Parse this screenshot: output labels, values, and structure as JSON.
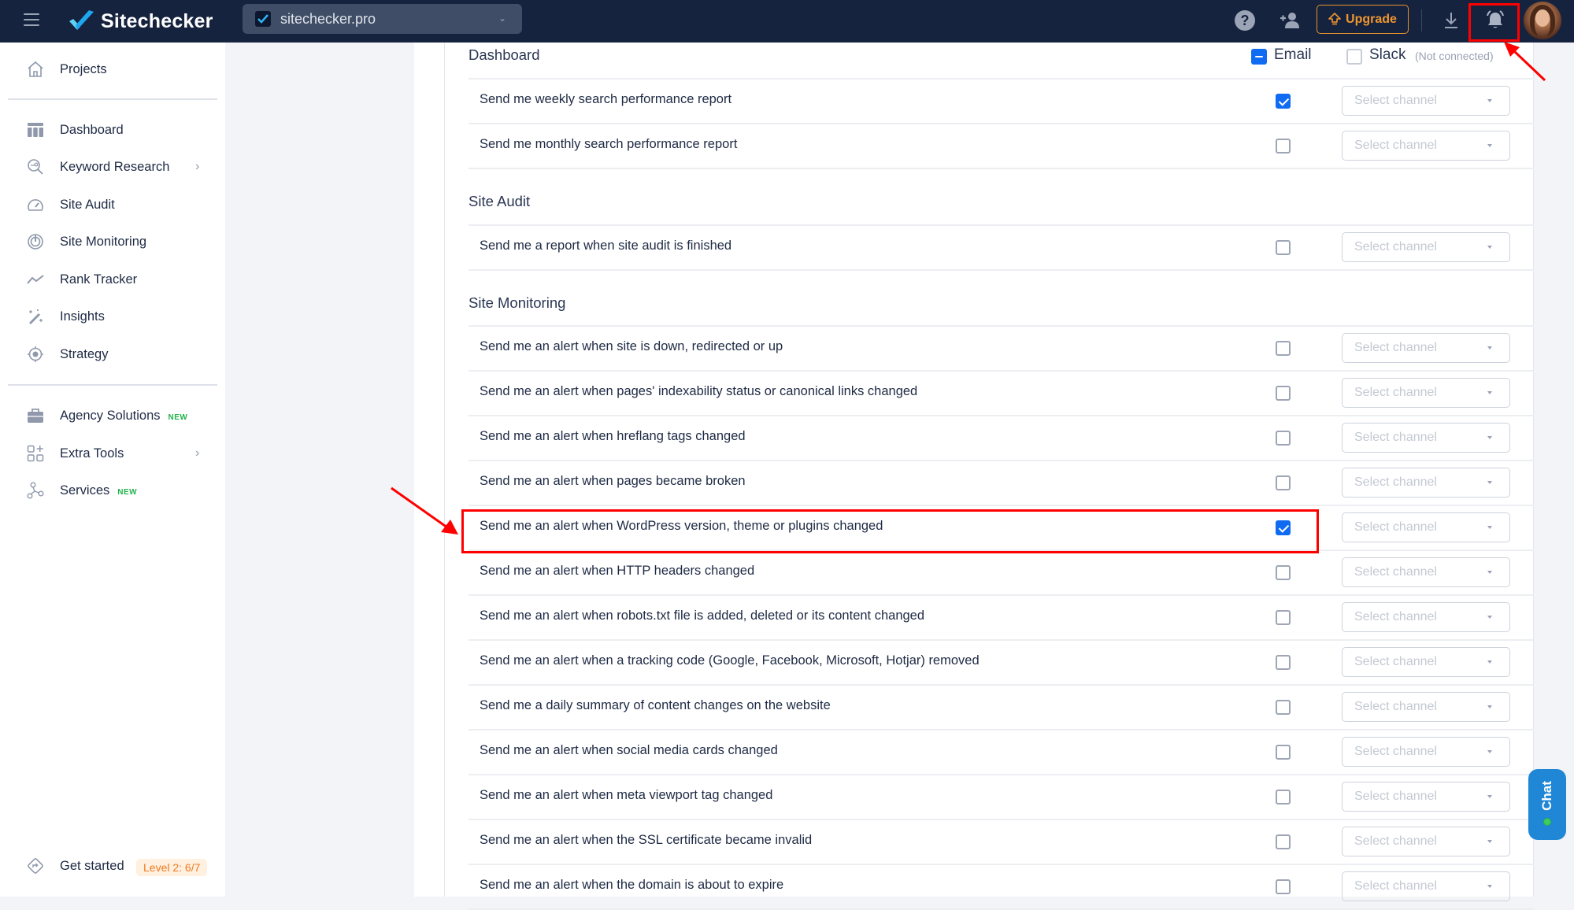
{
  "topbar": {
    "app_name": "Sitechecker",
    "project": "sitechecker.pro",
    "upgrade_label": "Upgrade",
    "icons": [
      "menu-icon",
      "help-icon",
      "add-user-icon",
      "download-icon",
      "bell-icon",
      "avatar"
    ]
  },
  "sidebar": {
    "projects_label": "Projects",
    "items": [
      {
        "label": "Dashboard",
        "icon": "dashboard-icon",
        "chevron": false,
        "badge": ""
      },
      {
        "label": "Keyword Research",
        "icon": "keyword-search-icon",
        "chevron": true,
        "badge": ""
      },
      {
        "label": "Site Audit",
        "icon": "gauge-icon",
        "chevron": false,
        "badge": ""
      },
      {
        "label": "Site Monitoring",
        "icon": "monitoring-icon",
        "chevron": false,
        "badge": ""
      },
      {
        "label": "Rank Tracker",
        "icon": "trend-icon",
        "chevron": false,
        "badge": ""
      },
      {
        "label": "Insights",
        "icon": "magic-wand-icon",
        "chevron": false,
        "badge": ""
      },
      {
        "label": "Strategy",
        "icon": "target-icon",
        "chevron": false,
        "badge": ""
      }
    ],
    "extra": [
      {
        "label": "Agency Solutions",
        "icon": "briefcase-icon",
        "chevron": false,
        "badge": "NEW"
      },
      {
        "label": "Extra Tools",
        "icon": "tools-grid-icon",
        "chevron": true,
        "badge": ""
      },
      {
        "label": "Services",
        "icon": "services-icon",
        "chevron": false,
        "badge": "NEW"
      }
    ],
    "get_started_label": "Get started",
    "level_badge": "Level 2: 6/7"
  },
  "notifications": {
    "channels_header": {
      "email_label": "Email",
      "email_state": "indeterminate",
      "slack_label": "Slack",
      "slack_checked": false,
      "slack_note": "(Not connected)"
    },
    "select_placeholder": "Select channel",
    "sections": [
      {
        "title": "Dashboard",
        "rows": [
          {
            "label": "Send me weekly search performance report",
            "email": true
          },
          {
            "label": "Send me monthly search performance report",
            "email": false
          }
        ]
      },
      {
        "title": "Site Audit",
        "rows": [
          {
            "label": "Send me a report when site audit is finished",
            "email": false
          }
        ]
      },
      {
        "title": "Site Monitoring",
        "rows": [
          {
            "label": "Send me an alert when site is down, redirected or up",
            "email": false
          },
          {
            "label": "Send me an alert when pages' indexability status or canonical links changed",
            "email": false
          },
          {
            "label": "Send me an alert when hreflang tags changed",
            "email": false
          },
          {
            "label": "Send me an alert when pages became broken",
            "email": false
          },
          {
            "label": "Send me an alert when WordPress version, theme or plugins changed",
            "email": true,
            "highlighted": true
          },
          {
            "label": "Send me an alert when HTTP headers changed",
            "email": false
          },
          {
            "label": "Send me an alert when robots.txt file is added, deleted or its content changed",
            "email": false
          },
          {
            "label": "Send me an alert when a tracking code (Google, Facebook, Microsoft, Hotjar) removed",
            "email": false
          },
          {
            "label": "Send me a daily summary of content changes on the website",
            "email": false
          },
          {
            "label": "Send me an alert when social media cards changed",
            "email": false
          },
          {
            "label": "Send me an alert when meta viewport tag changed",
            "email": false
          },
          {
            "label": "Send me an alert when the SSL certificate became invalid",
            "email": false
          },
          {
            "label": "Send me an alert when the domain is about to expire",
            "email": false
          }
        ]
      }
    ]
  },
  "chat": {
    "label": "Chat",
    "status_color": "#3ccd5a"
  },
  "colors": {
    "topbar_bg": "#16233f",
    "accent_blue": "#0f6cf2",
    "upgrade_orange": "#f0962e",
    "new_badge_green": "#23b24b",
    "annotation_red": "#ff0000",
    "chat_blue": "#1f87d6"
  }
}
